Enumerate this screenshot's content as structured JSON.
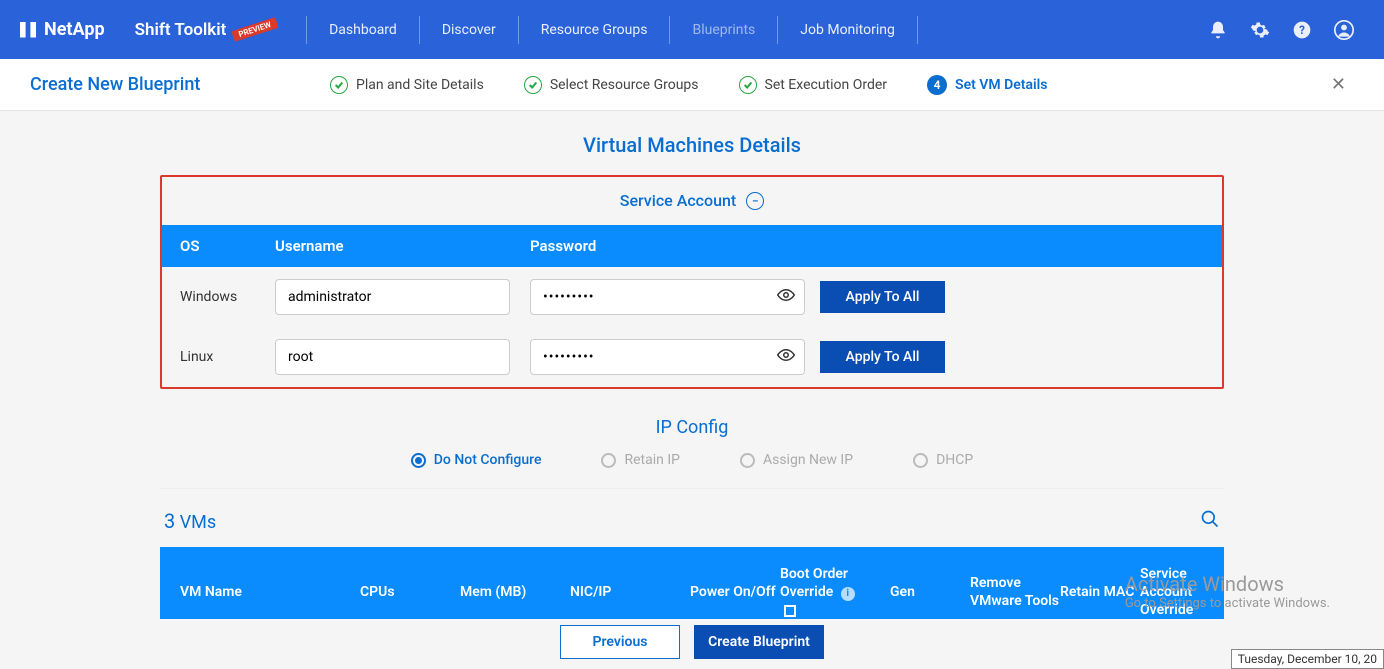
{
  "brand": "NetApp",
  "app_name": "Shift Toolkit",
  "preview_badge": "PREVIEW",
  "nav": {
    "items": [
      "Dashboard",
      "Discover",
      "Resource Groups",
      "Blueprints",
      "Job Monitoring"
    ],
    "active_index": 3
  },
  "wizard": {
    "title": "Create New Blueprint",
    "steps": [
      {
        "label": "Plan and Site Details",
        "state": "done"
      },
      {
        "label": "Select Resource Groups",
        "state": "done"
      },
      {
        "label": "Set Execution Order",
        "state": "done"
      },
      {
        "label": "Set VM Details",
        "state": "current",
        "number": "4"
      }
    ]
  },
  "section_vm_details_title": "Virtual Machines Details",
  "service_account": {
    "title": "Service Account",
    "cols": {
      "os": "OS",
      "username": "Username",
      "password": "Password"
    },
    "rows": [
      {
        "os": "Windows",
        "username": "administrator",
        "password": "•••••••••",
        "apply": "Apply To All"
      },
      {
        "os": "Linux",
        "username": "root",
        "password": "•••••••••",
        "apply": "Apply To All"
      }
    ]
  },
  "ip_config": {
    "title": "IP Config",
    "options": [
      "Do Not Configure",
      "Retain IP",
      "Assign New IP",
      "DHCP"
    ],
    "selected_index": 0
  },
  "vm_table": {
    "count_number": "3",
    "count_label": "VMs",
    "headers": {
      "name": "VM Name",
      "cpus": "CPUs",
      "mem": "Mem (MB)",
      "nic": "NIC/IP",
      "power": "Power On/Off",
      "boot": "Boot Order Override",
      "gen": "Gen",
      "rmv": "Remove VMware Tools",
      "mac": "Retain MAC",
      "svc": "Service Account Override"
    }
  },
  "footer": {
    "previous": "Previous",
    "create": "Create Blueprint"
  },
  "watermark": {
    "line1": "Activate Windows",
    "line2": "Go to Settings to activate Windows."
  },
  "timestamp": "Tuesday, December 10, 20"
}
